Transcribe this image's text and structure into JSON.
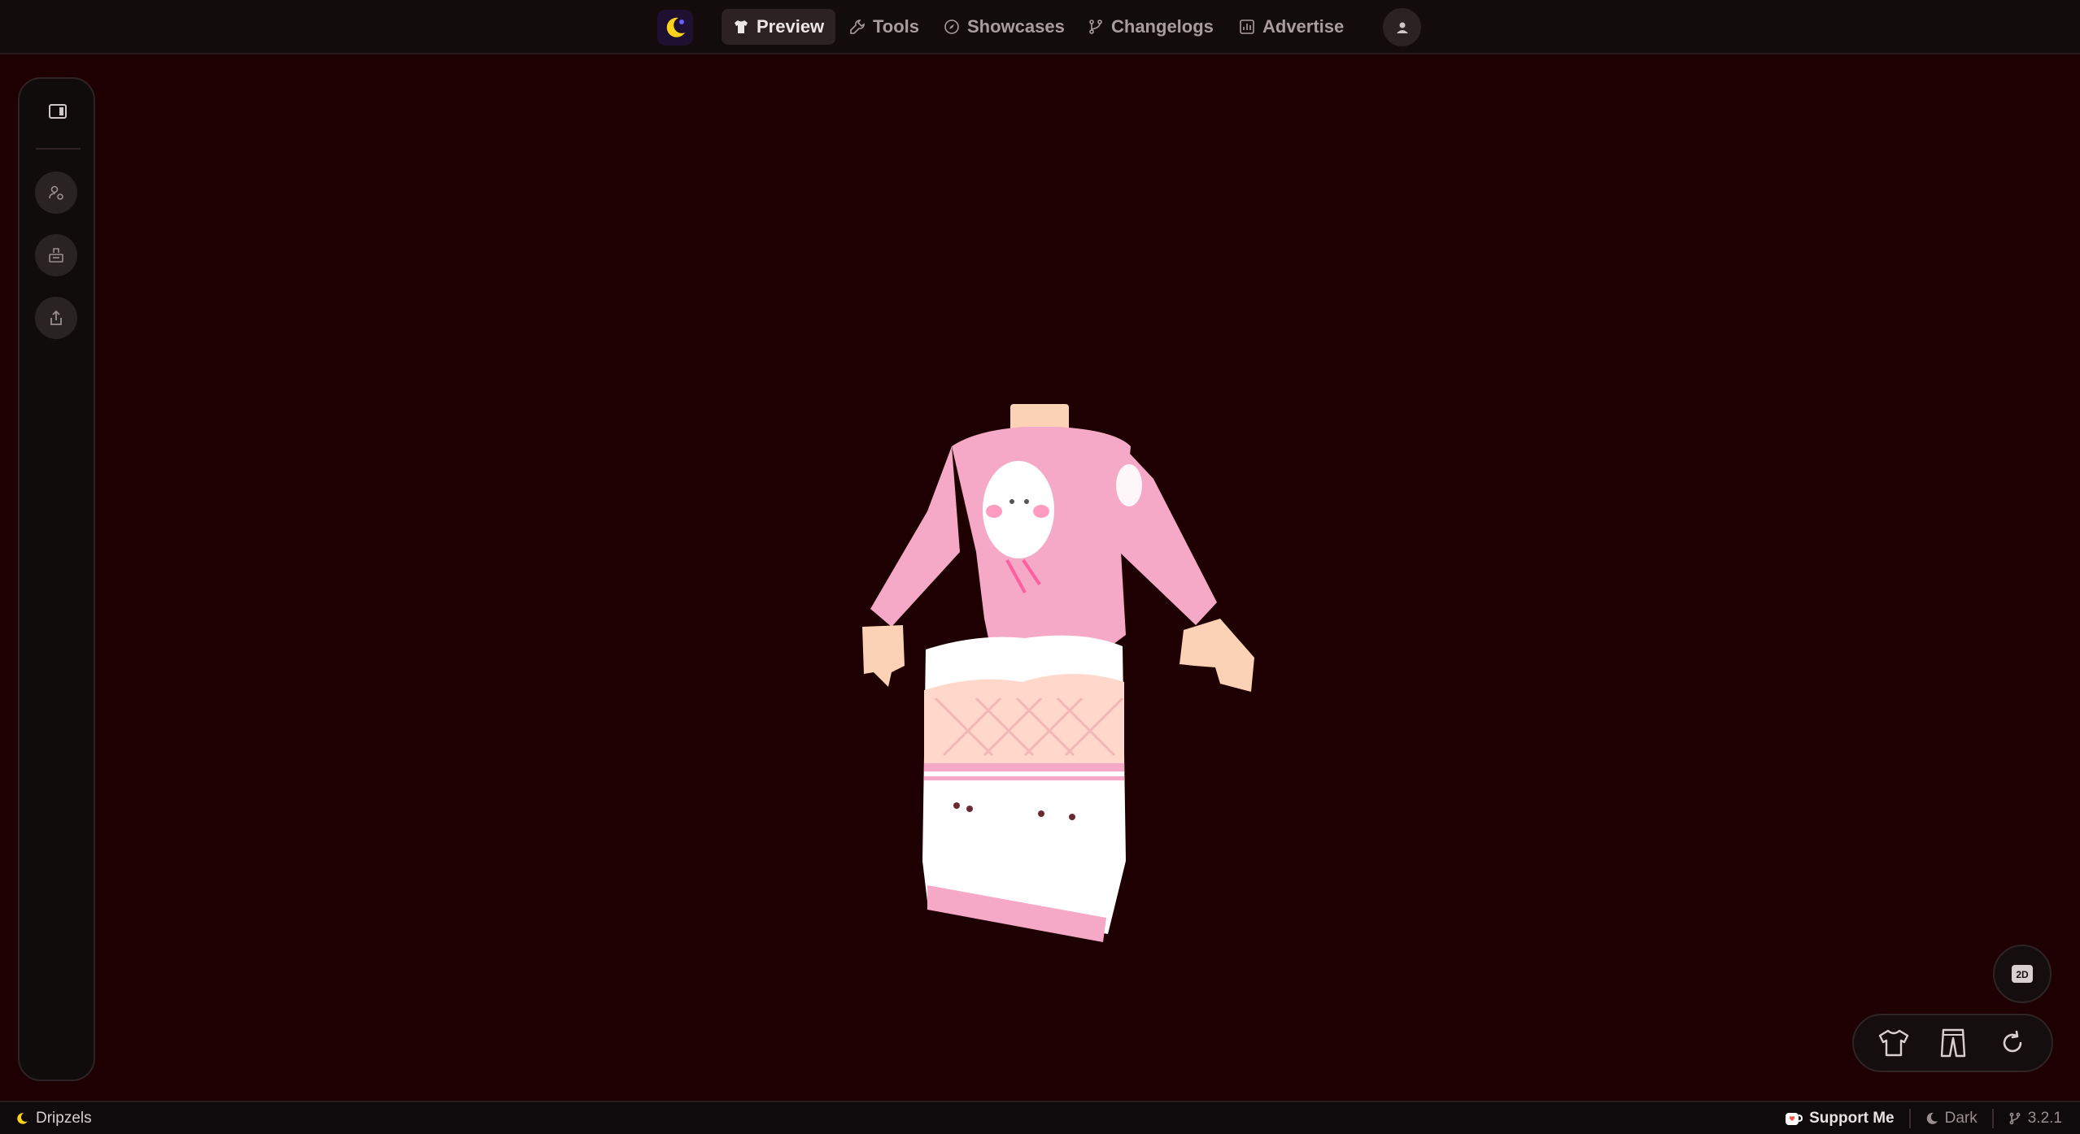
{
  "nav": {
    "items": [
      {
        "label": "Preview",
        "icon": "shirt-icon",
        "active": true
      },
      {
        "label": "Tools",
        "icon": "wrench-icon"
      },
      {
        "label": "Showcases",
        "icon": "compass-icon"
      },
      {
        "label": "Changelogs",
        "icon": "git-branch-icon"
      },
      {
        "label": "Advertise",
        "icon": "chart-icon"
      }
    ]
  },
  "toolbar": {
    "mode_label": "2D"
  },
  "footer": {
    "brand": "Dripzels",
    "support": "Support Me",
    "theme": "Dark",
    "version": "3.2.1"
  },
  "colors": {
    "background": "#1e0002",
    "shirt": "#f5a9c6",
    "skin": "#fbd2b6",
    "accent": "#e65a4a"
  }
}
